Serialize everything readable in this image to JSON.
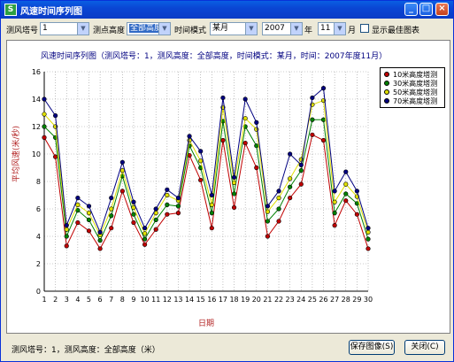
{
  "window": {
    "title": "风速时间序列图"
  },
  "toolbar": {
    "tower_label": "测风塔号",
    "tower_value": "1",
    "height_label": "测点高度",
    "height_value": "全部高度",
    "mode_label": "时间模式",
    "mode_value": "某月",
    "year_value": "2007",
    "year_label": "年",
    "month_value": "11",
    "month_label": "月",
    "best_label": "显示最佳图表"
  },
  "footer": {
    "status": "测风塔号：1，测风高度：全部高度（米）",
    "save_label": "保存图像(S)",
    "close_label": "关闭(C)"
  },
  "chart_data": {
    "type": "line",
    "title": "风速时间序列图（测风塔号：1，测风高度：全部高度，时间模式：某月，时间：2007年度11月）",
    "xlabel": "日期",
    "ylabel": "平均风速(米/秒)",
    "x": [
      1,
      2,
      3,
      4,
      5,
      6,
      7,
      8,
      9,
      10,
      11,
      12,
      13,
      14,
      15,
      16,
      17,
      18,
      19,
      20,
      21,
      22,
      23,
      24,
      25,
      26,
      27,
      28,
      29,
      30
    ],
    "ylim": [
      0,
      16
    ],
    "grid": true,
    "legend_position": "top-right",
    "series": [
      {
        "name": "10米高度塔测",
        "color": "#c00000",
        "values": [
          11.2,
          9.8,
          3.3,
          5.0,
          4.4,
          3.1,
          4.6,
          7.3,
          5.0,
          3.4,
          4.5,
          5.6,
          5.7,
          9.9,
          8.1,
          4.6,
          11.0,
          6.1,
          10.8,
          9.0,
          4.0,
          5.1,
          6.8,
          7.8,
          11.4,
          11.0,
          4.8,
          6.6,
          5.6,
          3.1
        ]
      },
      {
        "name": "30米高度塔测",
        "color": "#008000",
        "values": [
          12.0,
          11.2,
          4.0,
          5.9,
          5.2,
          3.7,
          5.5,
          8.4,
          5.6,
          3.8,
          5.2,
          6.3,
          6.2,
          10.6,
          9.0,
          5.7,
          12.4,
          7.1,
          12.0,
          10.6,
          5.1,
          6.0,
          7.6,
          8.8,
          12.5,
          12.5,
          5.7,
          7.1,
          6.4,
          3.8
        ]
      },
      {
        "name": "50米高度塔测",
        "color": "#e0e000",
        "values": [
          12.9,
          12.0,
          4.5,
          6.3,
          5.7,
          4.1,
          6.0,
          8.8,
          6.1,
          4.2,
          5.7,
          7.0,
          6.6,
          11.0,
          9.5,
          6.3,
          13.4,
          7.9,
          12.6,
          11.8,
          5.8,
          6.8,
          8.2,
          9.6,
          13.6,
          13.9,
          6.5,
          7.8,
          6.9,
          4.3
        ]
      },
      {
        "name": "70米高度塔测",
        "color": "#000080",
        "values": [
          14.0,
          12.8,
          4.8,
          6.8,
          6.2,
          4.3,
          6.8,
          9.4,
          6.5,
          4.6,
          6.0,
          7.4,
          6.8,
          11.3,
          10.2,
          7.0,
          14.1,
          8.3,
          14.0,
          12.3,
          6.2,
          7.3,
          10.0,
          9.2,
          14.1,
          14.8,
          7.3,
          8.7,
          7.3,
          4.6
        ]
      }
    ]
  }
}
